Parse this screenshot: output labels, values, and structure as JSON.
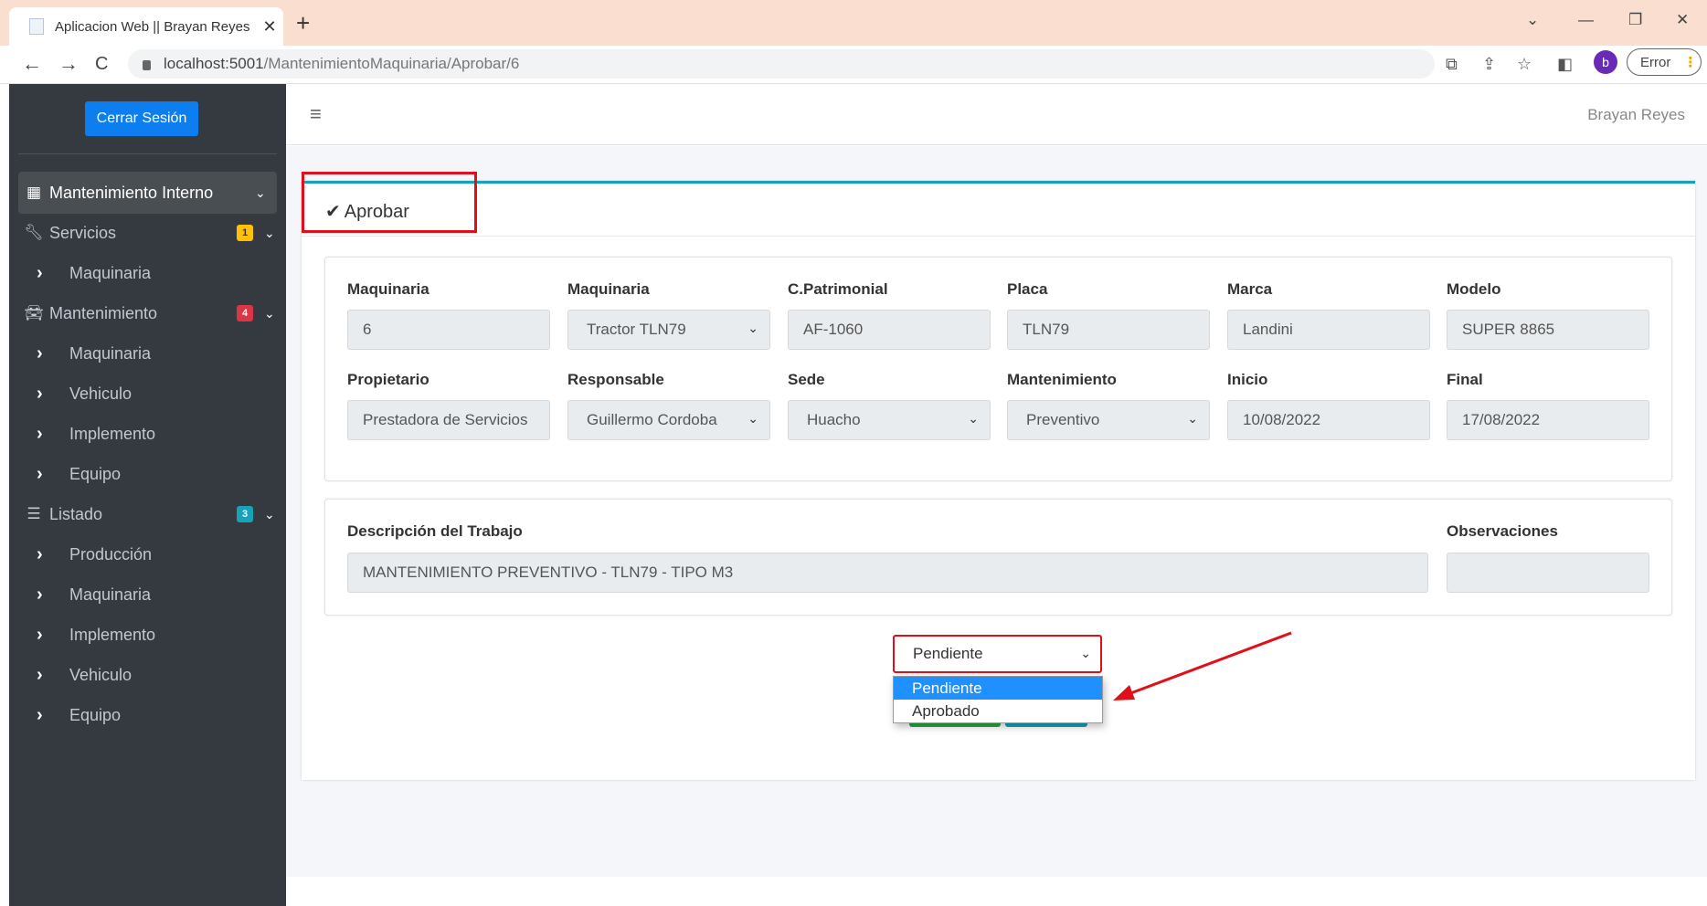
{
  "browser": {
    "tab_title": "Aplicacion Web || Brayan Reyes",
    "tab_close": "✕",
    "new_tab": "+",
    "url_host": "localhost:5001",
    "url_path": "/MantenimientoMaquinaria/Aprobar/6",
    "profile_letter": "b",
    "error_label": "Error"
  },
  "sidebar": {
    "logout_label": "Cerrar Sesión",
    "menu": [
      {
        "label": "Mantenimiento Interno",
        "icon": "grid-icon"
      },
      {
        "label": "Servicios",
        "icon": "wrench-icon",
        "badge": "1",
        "badge_color": "#ffc107"
      },
      {
        "label": "Maquinaria"
      },
      {
        "label": "Mantenimiento",
        "icon": "car-icon",
        "badge": "4",
        "badge_color": "#dc3545"
      },
      {
        "label": "Maquinaria"
      },
      {
        "label": "Vehiculo"
      },
      {
        "label": "Implemento"
      },
      {
        "label": "Equipo"
      },
      {
        "label": "Listado",
        "icon": "list-icon",
        "badge": "3",
        "badge_color": "#17a2b8"
      },
      {
        "label": "Producción"
      },
      {
        "label": "Maquinaria"
      },
      {
        "label": "Implemento"
      },
      {
        "label": "Vehiculo"
      },
      {
        "label": "Equipo"
      }
    ]
  },
  "header": {
    "user_name": "Brayan Reyes"
  },
  "card": {
    "title": "Aprobar"
  },
  "form": {
    "row1": [
      {
        "label": "Maquinaria",
        "value": "6",
        "type": "input"
      },
      {
        "label": "Maquinaria",
        "value": "Tractor TLN79",
        "type": "select"
      },
      {
        "label": "C.Patrimonial",
        "value": "AF-1060",
        "type": "input"
      },
      {
        "label": "Placa",
        "value": "TLN79",
        "type": "input"
      },
      {
        "label": "Marca",
        "value": "Landini",
        "type": "input"
      },
      {
        "label": "Modelo",
        "value": "SUPER 8865",
        "type": "input"
      }
    ],
    "row2": [
      {
        "label": "Propietario",
        "value": "Prestadora de Servicios",
        "type": "input"
      },
      {
        "label": "Responsable",
        "value": "Guillermo Cordoba",
        "type": "select"
      },
      {
        "label": "Sede",
        "value": "Huacho",
        "type": "select"
      },
      {
        "label": "Mantenimiento",
        "value": "Preventivo",
        "type": "select"
      },
      {
        "label": "Inicio",
        "value": "10/08/2022",
        "type": "input"
      },
      {
        "label": "Final",
        "value": "17/08/2022",
        "type": "input"
      }
    ],
    "descripcion_label": "Descripción del Trabajo",
    "descripcion_value": "MANTENIMIENTO PREVENTIVO - TLN79 - TIPO M3",
    "observaciones_label": "Observaciones",
    "observaciones_value": ""
  },
  "status": {
    "selected": "Pendiente",
    "options": [
      "Pendiente",
      "Aprobado"
    ]
  },
  "colors": {
    "highlight_red": "#e0101a",
    "card_accent": "#17a2b8",
    "sidebar_bg": "#343a40",
    "primary": "#0d7ef0"
  }
}
